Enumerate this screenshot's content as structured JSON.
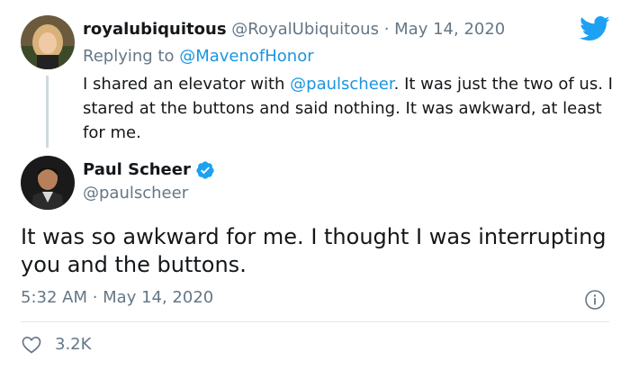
{
  "reply_tweet": {
    "display_name": "royalubiquitous",
    "handle": "@RoyalUbiquitous",
    "separator": "·",
    "date": "May 14, 2020",
    "replying_prefix": "Replying to",
    "replying_to": "@MavenofHonor",
    "text_before_mention": "I shared an elevator with ",
    "mention": "@paulscheer",
    "text_after_mention": ". It was just the two of us. I stared at the buttons and said nothing. It was awkward, at least for me."
  },
  "main_tweet": {
    "display_name": "Paul Scheer",
    "handle": "@paulscheer",
    "text": "It was so awkward for me. I thought I was interrupting you and the buttons.",
    "timestamp": "5:32 AM · May 14, 2020",
    "like_count": "3.2K"
  },
  "icons": {
    "brand": "twitter-bird-icon",
    "verified": "verified-badge-icon",
    "info": "info-icon",
    "like": "heart-icon"
  },
  "colors": {
    "brand_blue": "#1da1f2",
    "link_blue": "#1b95e0",
    "secondary_text": "#657786",
    "primary_text": "#14171a"
  }
}
